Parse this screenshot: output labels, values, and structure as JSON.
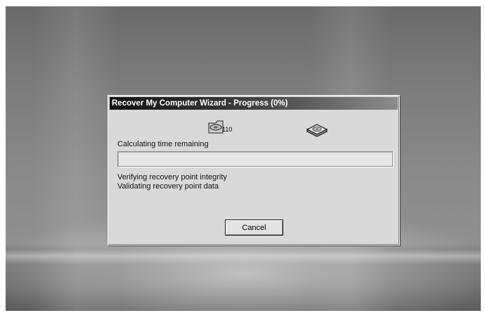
{
  "dialog": {
    "title": "Recover My Computer Wizard - Progress  (0%)",
    "progress_percent": 0,
    "status": "Calculating time remaining",
    "log": [
      "Verifying recovery point integrity",
      "Validating recovery point data"
    ],
    "cancel_label": "Cancel",
    "animation_text": "110",
    "icons": {
      "source": "folder-disk-icon",
      "destination": "hard-disk-icon"
    }
  }
}
